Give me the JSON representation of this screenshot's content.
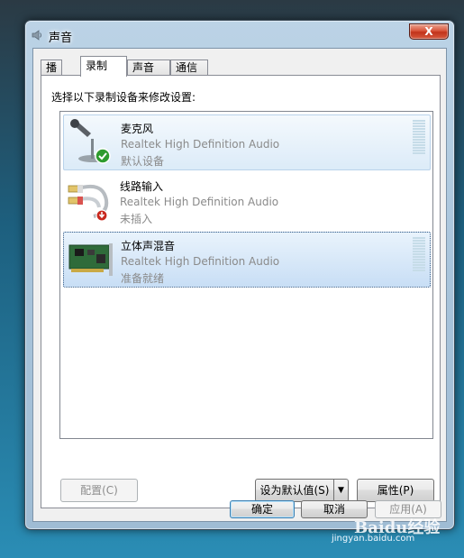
{
  "window": {
    "title": "声音",
    "close_label": "X"
  },
  "tabs": [
    {
      "label": "播放",
      "active": false
    },
    {
      "label": "录制",
      "active": true
    },
    {
      "label": "声音",
      "active": false
    },
    {
      "label": "通信",
      "active": false
    }
  ],
  "recording": {
    "instruction": "选择以下录制设备来修改设置:",
    "devices": [
      {
        "name": "麦克风",
        "description": "Realtek High Definition Audio",
        "status": "默认设备",
        "icon": "microphone-icon",
        "badge": "check-icon"
      },
      {
        "name": "线路输入",
        "description": "Realtek High Definition Audio",
        "status": "未插入",
        "icon": "rca-cable-icon",
        "badge": "unplugged-icon"
      },
      {
        "name": "立体声混音",
        "description": "Realtek High Definition Audio",
        "status": "准备就绪",
        "icon": "sound-card-icon",
        "badge": ""
      }
    ]
  },
  "buttons": {
    "configure": "配置(C)",
    "set_default": "设为默认值(S)",
    "properties": "属性(P)",
    "ok": "确定",
    "cancel": "取消",
    "apply": "应用(A)"
  },
  "watermark": {
    "logo": "Baidu经验",
    "url": "jingyan.baidu.com"
  },
  "colors": {
    "selection_border": "#3a5e86",
    "default_badge": "#2e9b2e",
    "unplugged_badge": "#c8281e"
  }
}
